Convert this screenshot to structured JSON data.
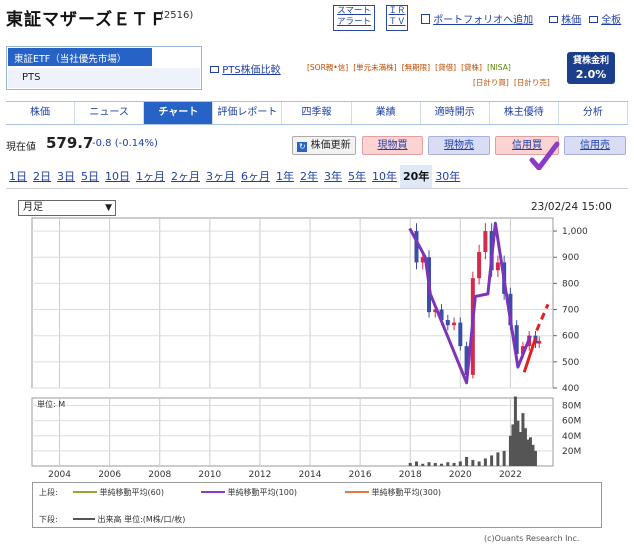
{
  "header": {
    "title": "東証マザーズＥＴＦ",
    "code": "(2516)",
    "smart_alert": [
      "スマート",
      "アラート"
    ],
    "irtv": [
      "ＩＲ",
      "ＴＶ"
    ],
    "portfolio_link": "ポートフォリオへ追加",
    "stock_price_link": "株価",
    "all_board_link": "全板"
  },
  "market": {
    "selected": "東証ETF（当社優先市場）",
    "other": "PTS",
    "pts_compare": "PTS株価比較"
  },
  "tags": {
    "row1": [
      "[SOR親•信]",
      "[単元未満株]",
      "[無期限]",
      "[貸借]",
      "[貸株]",
      "[NISA]"
    ],
    "row2": [
      "[日計り買]",
      "[日計り売]"
    ]
  },
  "taikin": {
    "label": "貸株金利",
    "rate": "2.0%"
  },
  "nav": [
    "株価",
    "ニュース",
    "チャート",
    "評価レポート",
    "四季報",
    "業績",
    "適時開示",
    "株主優待",
    "分析"
  ],
  "nav_active": "チャート",
  "price": {
    "label": "現在値",
    "value": "579.7",
    "change": "-0.8 (-0.14%)",
    "refresh": "株価更新",
    "buy_spot": "現物買",
    "sell_spot": "現物売",
    "buy_margin": "信用買",
    "sell_margin": "信用売"
  },
  "ranges": [
    "1日",
    "2日",
    "3日",
    "5日",
    "10日",
    "1ヶ月",
    "2ヶ月",
    "3ヶ月",
    "6ヶ月",
    "1年",
    "2年",
    "3年",
    "5年",
    "10年",
    "20年",
    "30年"
  ],
  "range_active": "20年",
  "chart_controls": {
    "period_select": "月足",
    "timestamp": "23/02/24 15:00"
  },
  "chart_data": [
    {
      "type": "line",
      "title": "",
      "x": [
        2017.0,
        2017.25,
        2017.5,
        2017.75,
        2018.0,
        2018.25,
        2018.5,
        2018.75,
        2019.0,
        2019.25,
        2019.5,
        2019.75,
        2020.0,
        2020.25,
        2020.5,
        2020.75,
        2021.0,
        2021.25,
        2021.5,
        2021.75,
        2022.0,
        2022.25,
        2022.5,
        2022.75,
        2023.0,
        2023.15
      ],
      "ylim": [
        400,
        1050
      ],
      "yticks": [
        "1,000",
        "900",
        "800",
        "700",
        "600",
        "500",
        "400"
      ],
      "xticks": [
        "2004",
        "2006",
        "2008",
        "2010",
        "2012",
        "2014",
        "2016",
        "2018",
        "2020",
        "2022"
      ],
      "series": [
        {
          "values": [
            null,
            null,
            null,
            null,
            1000,
            880,
            900,
            690,
            700,
            660,
            640,
            650,
            560,
            450,
            820,
            920,
            1000,
            850,
            880,
            760,
            640,
            530,
            560,
            600,
            570,
            580
          ]
        },
        {
          "values": [
            null,
            null,
            null,
            null,
            null,
            null,
            null,
            null,
            null,
            null,
            null,
            null,
            null,
            null,
            null,
            null,
            null,
            null,
            null,
            null,
            null,
            null,
            null,
            null,
            null,
            null
          ]
        },
        {
          "values": [
            null,
            null,
            null,
            null,
            null,
            null,
            null,
            null,
            null,
            null,
            null,
            null,
            null,
            null,
            null,
            null,
            null,
            null,
            null,
            null,
            null,
            null,
            null,
            null,
            null,
            null
          ]
        }
      ],
      "colors": {
        "up": "#d62a4a",
        "down": "#3a4ea8",
        "ma60": "#9aa530",
        "ma100": "#8a3cc7",
        "ma300": "#e07a3a"
      },
      "annotations": {
        "purple_zigzag": [
          [
            2017.98,
            1010
          ],
          [
            2018.6,
            900
          ],
          [
            2018.8,
            760
          ],
          [
            2020.25,
            420
          ],
          [
            2020.6,
            750
          ],
          [
            2021.1,
            760
          ],
          [
            2021.4,
            1030
          ],
          [
            2021.9,
            720
          ],
          [
            2022.3,
            480
          ],
          [
            2022.8,
            600
          ]
        ],
        "red_line": [
          [
            2022.55,
            460
          ],
          [
            2023.0,
            590
          ]
        ],
        "red_dashed": [
          [
            2023.05,
            620
          ],
          [
            2023.5,
            720
          ]
        ]
      }
    },
    {
      "type": "bar",
      "title": "",
      "ylabel": "単位: M",
      "yticks": [
        "80M",
        "60M",
        "40M",
        "20M"
      ],
      "ylim": [
        0,
        90
      ],
      "x": [
        2018.0,
        2018.25,
        2018.5,
        2018.75,
        2019.0,
        2019.25,
        2019.5,
        2019.75,
        2020.0,
        2020.25,
        2020.5,
        2020.75,
        2021.0,
        2021.25,
        2021.5,
        2021.75,
        2022.0,
        2022.1,
        2022.2,
        2022.3,
        2022.4,
        2022.5,
        2022.6,
        2022.7,
        2022.8,
        2022.9,
        2023.0
      ],
      "values": [
        4,
        6,
        3,
        5,
        4,
        3,
        5,
        4,
        6,
        12,
        8,
        6,
        10,
        14,
        18,
        20,
        40,
        55,
        92,
        60,
        45,
        70,
        50,
        35,
        38,
        28,
        20
      ]
    }
  ],
  "legend": {
    "upper_label": "上段:",
    "ma60": "単純移動平均(60)",
    "ma100": "単純移動平均(100)",
    "ma300": "単純移動平均(300)",
    "lower_label": "下段:",
    "volume": "出来高 単位:(M株/口/枚)"
  },
  "credit": "(c)Ouants Research Inc."
}
